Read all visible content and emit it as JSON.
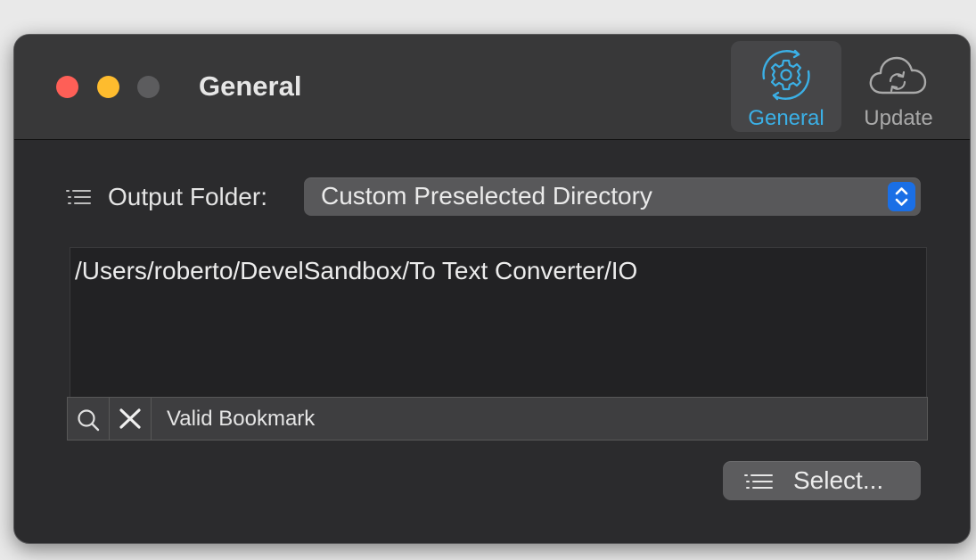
{
  "window": {
    "title": "General"
  },
  "toolbar": {
    "items": [
      {
        "label": "General",
        "icon": "gear-refresh-icon",
        "selected": true,
        "color": "#3bb0e6"
      },
      {
        "label": "Update",
        "icon": "cloud-sync-icon",
        "selected": false,
        "color": "#a9a9a9"
      }
    ]
  },
  "output_folder": {
    "label": "Output Folder:",
    "selected_option": "Custom Preselected Directory",
    "path": "/Users/roberto/DevelSandbox/To Text Converter/IO"
  },
  "bookmark": {
    "status": "Valid Bookmark"
  },
  "select_button": {
    "label": "Select..."
  },
  "colors": {
    "traffic_red": "#fe5f57",
    "traffic_yellow": "#febc2e",
    "accent_blue": "#1a6fe6"
  }
}
